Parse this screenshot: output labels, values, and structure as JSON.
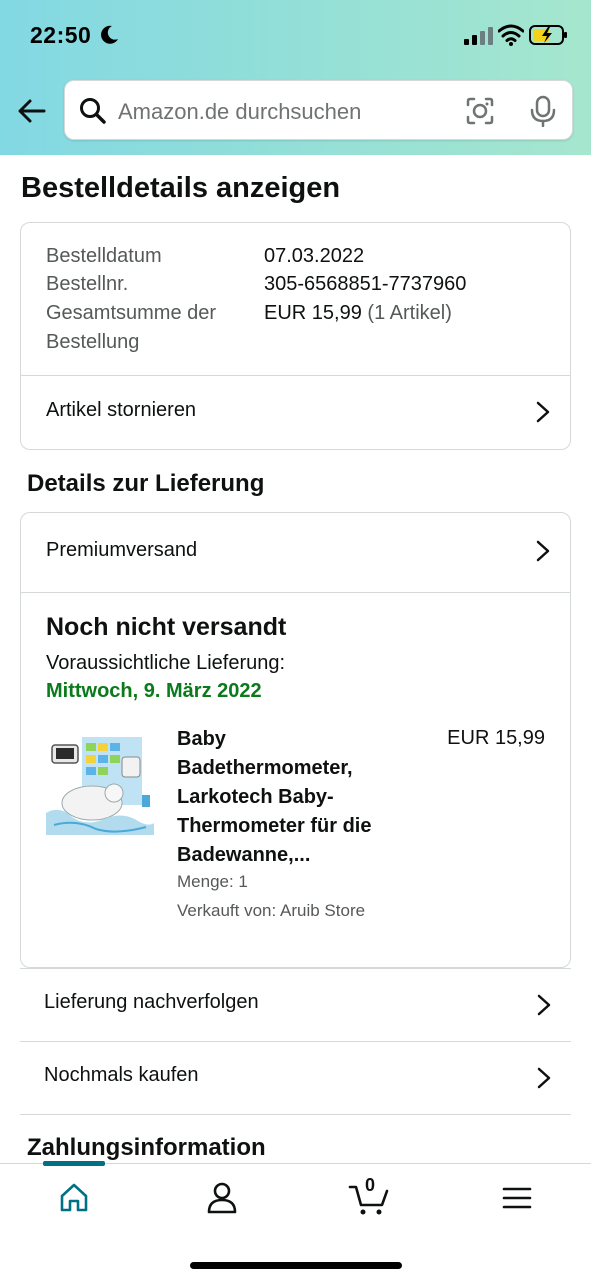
{
  "status_bar": {
    "time": "22:50",
    "icons": [
      "moon-icon",
      "signal-icon",
      "wifi-icon",
      "battery-charging-icon"
    ]
  },
  "search": {
    "placeholder": "Amazon.de durchsuchen"
  },
  "page": {
    "title": "Bestelldetails anzeigen"
  },
  "order": {
    "date_label": "Bestelldatum",
    "date_value": "07.03.2022",
    "number_label": "Bestellnr.",
    "number_value": "305-6568851-7737960",
    "total_label_1": "Gesamtsumme der",
    "total_label_2": "Bestellung",
    "total_value": "EUR 15,99",
    "total_items": "(1 Artikel)",
    "cancel_label": "Artikel stornieren"
  },
  "delivery": {
    "section_title": "Details zur Lieferung",
    "shipping_method": "Premiumversand",
    "status": "Noch nicht versandt",
    "eta_label": "Voraussichtliche Lieferung:",
    "eta_date": "Mittwoch, 9. März 2022",
    "item": {
      "title_1": "Baby",
      "title_2": "Badethermometer,",
      "title_3": "Larkotech Baby-",
      "title_4": "Thermometer für die",
      "title_5": "Badewanne,...",
      "price": "EUR 15,99",
      "quantity": "Menge: 1",
      "seller": "Verkauft von: Aruib Store"
    }
  },
  "actions": {
    "track": "Lieferung nachverfolgen",
    "buy_again": "Nochmals kaufen"
  },
  "payment": {
    "section_title": "Zahlungsinformation"
  },
  "tabbar": {
    "cart_count": "0",
    "icons": [
      "home-icon",
      "account-icon",
      "cart-icon",
      "menu-icon"
    ]
  },
  "colors": {
    "accent": "#007185",
    "delivery_green": "#0b7a1c",
    "header_start": "#82d8e3",
    "header_end": "#a5e6ce"
  }
}
